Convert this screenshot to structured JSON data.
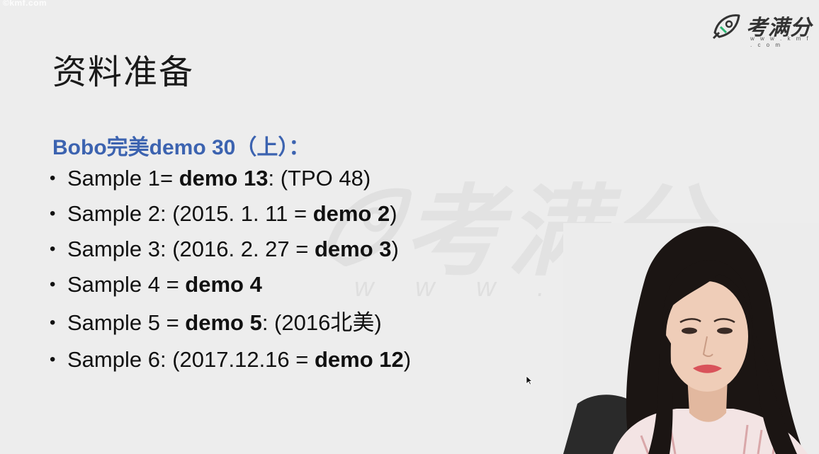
{
  "watermark": {
    "corner": "©kmf.com",
    "brand": "考满分",
    "url": "w w w . k m f . c o m",
    "center_brand": "考满分",
    "center_url": "w w w . k m f . c o m"
  },
  "slide": {
    "title": "资料准备",
    "subtitle": "Bobo完美demo 30（上）：",
    "bullets": [
      {
        "pre": "Sample 1= ",
        "bold": "demo 13",
        "post": ": (TPO 48)"
      },
      {
        "pre": "Sample 2: (2015. 1. 11 = ",
        "bold": "demo 2",
        "post": ")"
      },
      {
        "pre": "Sample 3: (2016. 2. 27 = ",
        "bold": "demo 3",
        "post": ")"
      },
      {
        "pre": "Sample 4 = ",
        "bold": "demo 4",
        "post": ""
      },
      {
        "pre": "Sample 5 = ",
        "bold": "demo 5",
        "post": ": (2016北美)"
      },
      {
        "pre": "Sample 6: (2017.12.16 = ",
        "bold": "demo 12",
        "post": ")"
      }
    ]
  },
  "colors": {
    "background": "#ededed",
    "subtitle": "#3c63b0",
    "text": "#111111"
  }
}
